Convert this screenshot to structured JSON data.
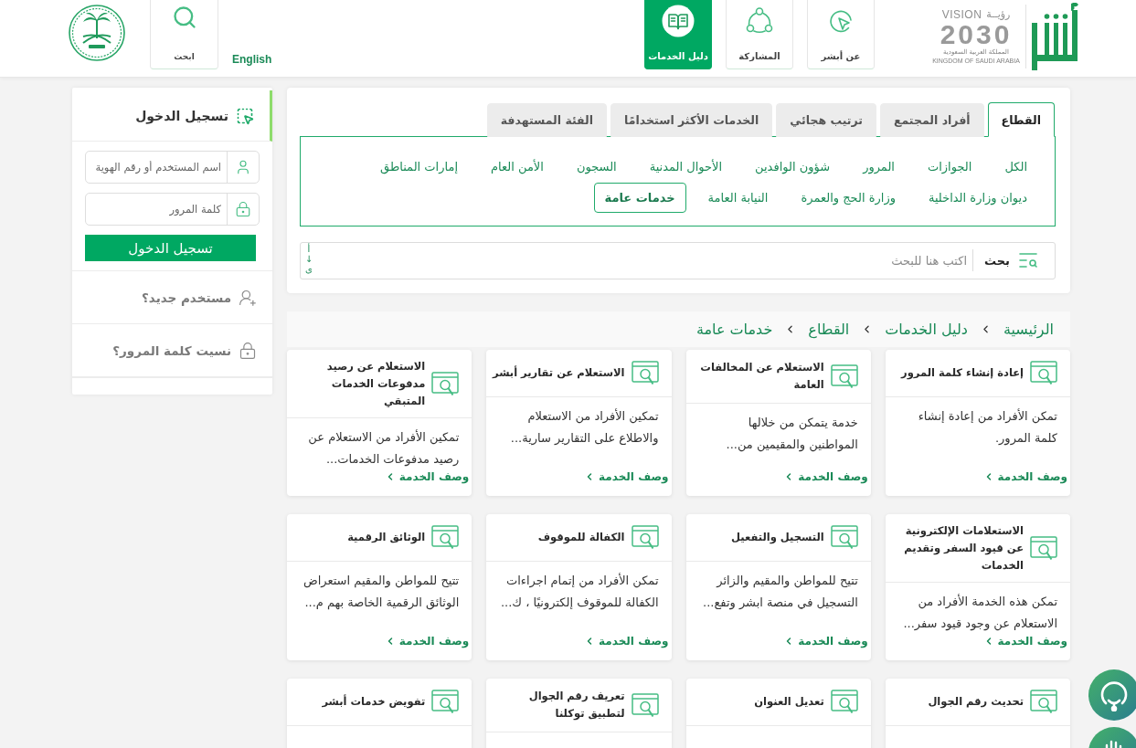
{
  "header": {
    "vision_logo": {
      "arabic_word": "رؤيــة",
      "word": "VISION",
      "year": "2030",
      "country_ar": "المملكة العربية السعودية",
      "country_en": "KINGDOM OF SAUDI ARABIA"
    },
    "nav": [
      {
        "label": "عن أبشر",
        "selected": false
      },
      {
        "label": "المشاركة",
        "selected": false
      },
      {
        "label": "دليل الخدمات",
        "selected": true
      }
    ],
    "language_link": "English",
    "search_button": "ابحث"
  },
  "tabs": [
    {
      "label": "القطاع",
      "selected": true
    },
    {
      "label": "أفراد المجتمع",
      "selected": false
    },
    {
      "label": "ترتيب هجائي",
      "selected": false
    },
    {
      "label": "الخدمات الأكثر استخدامًا",
      "selected": false
    },
    {
      "label": "الفئة المستهدفة",
      "selected": false
    }
  ],
  "sector_rows": [
    {
      "items": [
        {
          "label": "الكل",
          "selected": false
        },
        {
          "label": "الجوازات",
          "selected": false
        },
        {
          "label": "المرور",
          "selected": false
        },
        {
          "label": "شؤون الوافدين",
          "selected": false
        },
        {
          "label": "الأحوال المدنية",
          "selected": false
        },
        {
          "label": "السجون",
          "selected": false
        },
        {
          "label": "الأمن العام",
          "selected": false
        },
        {
          "label": "إمارات المناطق",
          "selected": false
        }
      ]
    },
    {
      "items": [
        {
          "label": "ديوان وزارة الداخلية",
          "selected": false
        },
        {
          "label": "وزارة الحج والعمرة",
          "selected": false
        },
        {
          "label": "النيابة العامة",
          "selected": false
        },
        {
          "label": "خدمات عامة",
          "selected": true
        }
      ]
    }
  ],
  "search": {
    "button_label": "بحث",
    "placeholder": "اكتب هنا للبحث",
    "sort_label": "أ↓ى"
  },
  "breadcrumb": [
    "الرئيسية",
    "دليل الخدمات",
    "القطاع",
    "خدمات عامة"
  ],
  "cards": [
    {
      "title": "إعادة إنشاء كلمة المرور",
      "description": "تمكن الأفراد من إعادة إنشاء كلمة المرور.",
      "link": "وصف الخدمة"
    },
    {
      "title": "الاستعلام عن المخالفات العامة",
      "description": "خدمة يتمكن من خلالها المواطنين والمقيمين من...",
      "link": "وصف الخدمة"
    },
    {
      "title": "الاستعلام عن تقارير أبشر",
      "description": "تمكين الأفراد من الاستعلام والاطلاع على التقارير سارية...",
      "link": "وصف الخدمة"
    },
    {
      "title": "الاستعلام عن رصيد مدفوعات الخدمات المتبقي",
      "description": "تمكين الأفراد من الاستعلام عن رصيد مدفوعات الخدمات...",
      "link": "وصف الخدمة"
    },
    {
      "title": "الاستعلامات الإلكترونية عن قيود السفر وتقديم الخدمات",
      "description": "تمكن هذه الخدمة الأفراد من الاستعلام عن وجود قيود سفر...",
      "link": "وصف الخدمة"
    },
    {
      "title": "التسجيل والتفعيل",
      "description": "تتيح للمواطن والمقيم والزائر التسجيل في منصة ابشر وتفع...",
      "link": "وصف الخدمة"
    },
    {
      "title": "الكفالة للموقوف",
      "description": "تمكن الأفراد من إتمام اجراءات الكفالة للموقوف إلكترونيًا ، ك...",
      "link": "وصف الخدمة"
    },
    {
      "title": "الوثائق الرقمية",
      "description": "تتيح للمواطن والمقيم استعراض الوثائق الرقمية الخاصة بهم م...",
      "link": "وصف الخدمة"
    },
    {
      "title": "تحديث رقم الجوال"
    },
    {
      "title": "تعديل العنوان"
    },
    {
      "title": "تعريف رقم الجوال لتطبيق توكلنا"
    },
    {
      "title": "تفويض خدمات أبشر"
    }
  ],
  "login": {
    "title": "تسجيل الدخول",
    "username_placeholder": "اسم المستخدم أو رقم الهوية",
    "password_placeholder": "كلمة المرور",
    "submit": "تسجيل الدخول",
    "links": [
      "مستخدم جديد؟",
      "نسيت كلمة المرور؟"
    ]
  }
}
